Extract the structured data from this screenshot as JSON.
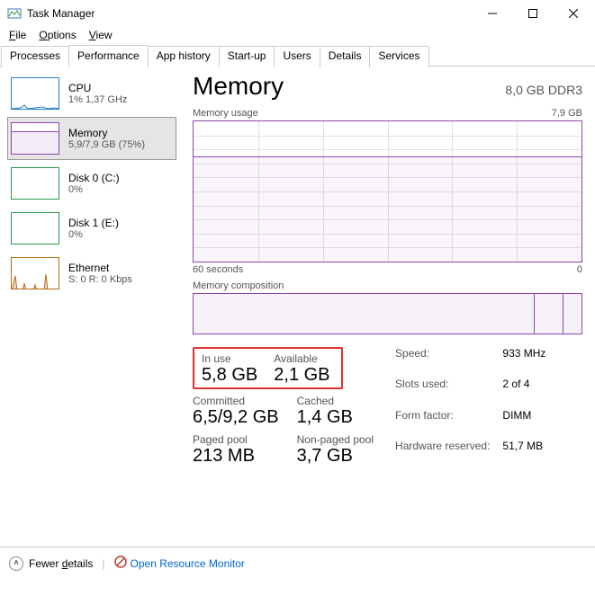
{
  "window": {
    "title": "Task Manager"
  },
  "menus": {
    "file": "File",
    "options": "Options",
    "view": "View"
  },
  "tabs": {
    "processes": "Processes",
    "performance": "Performance",
    "app_history": "App history",
    "startup": "Start-up",
    "users": "Users",
    "details": "Details",
    "services": "Services"
  },
  "sidebar": {
    "cpu": {
      "title": "CPU",
      "sub": "1%  1,37 GHz"
    },
    "memory": {
      "title": "Memory",
      "sub": "5,9/7,9 GB (75%)"
    },
    "disk0": {
      "title": "Disk 0 (C:)",
      "sub": "0%"
    },
    "disk1": {
      "title": "Disk 1 (E:)",
      "sub": "0%"
    },
    "ethernet": {
      "title": "Ethernet",
      "sub": "S: 0 R: 0 Kbps"
    }
  },
  "main": {
    "heading": "Memory",
    "capacity": "8,0 GB DDR3",
    "usage_label": "Memory usage",
    "usage_max": "7,9 GB",
    "xlabel_left": "60 seconds",
    "xlabel_right": "0",
    "comp_label": "Memory composition"
  },
  "stats": {
    "in_use_lbl": "In use",
    "in_use": "5,8 GB",
    "available_lbl": "Available",
    "available": "2,1 GB",
    "committed_lbl": "Committed",
    "committed": "6,5/9,2 GB",
    "cached_lbl": "Cached",
    "cached": "1,4 GB",
    "paged_lbl": "Paged pool",
    "paged": "213 MB",
    "nonpaged_lbl": "Non-paged pool",
    "nonpaged": "3,7 GB"
  },
  "right": {
    "speed_lbl": "Speed:",
    "speed": "933 MHz",
    "slots_lbl": "Slots used:",
    "slots": "2 of 4",
    "form_lbl": "Form factor:",
    "form": "DIMM",
    "hw_lbl": "Hardware reserved:",
    "hw": "51,7 MB"
  },
  "footer": {
    "fewer": "Fewer details",
    "orm": "Open Resource Monitor"
  },
  "chart_data": {
    "type": "line",
    "title": "Memory usage",
    "xlabel": "seconds ago",
    "ylabel": "GB",
    "xlim": [
      60,
      0
    ],
    "ylim": [
      0,
      7.9
    ],
    "series": [
      {
        "name": "In use",
        "x": [
          60,
          50,
          40,
          30,
          20,
          10,
          0
        ],
        "values": [
          5.9,
          5.9,
          5.9,
          5.9,
          5.9,
          5.9,
          5.9
        ]
      }
    ]
  }
}
